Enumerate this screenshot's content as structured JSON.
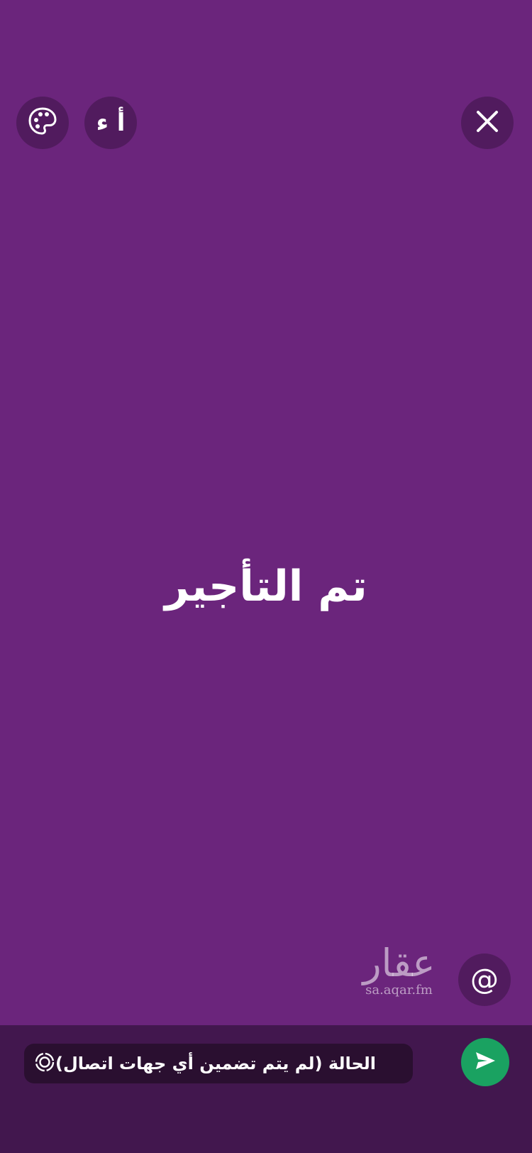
{
  "toolbar": {
    "font_button_label": "أ ء"
  },
  "status": {
    "text": "تم التأجير"
  },
  "mention": {
    "label": "@"
  },
  "watermark": {
    "logo_text": "عقار",
    "url": "sa.aqar.fm"
  },
  "bottom_bar": {
    "privacy_label": "الحالة (لم يتم تضمين أي جهات اتصال)"
  },
  "colors": {
    "background": "#6b257c",
    "bottom_bar": "#42174e",
    "send_button": "#1aa261"
  },
  "icons": {
    "close": "close-icon",
    "palette": "palette-icon",
    "privacy": "status-ring-icon",
    "send": "send-icon"
  }
}
